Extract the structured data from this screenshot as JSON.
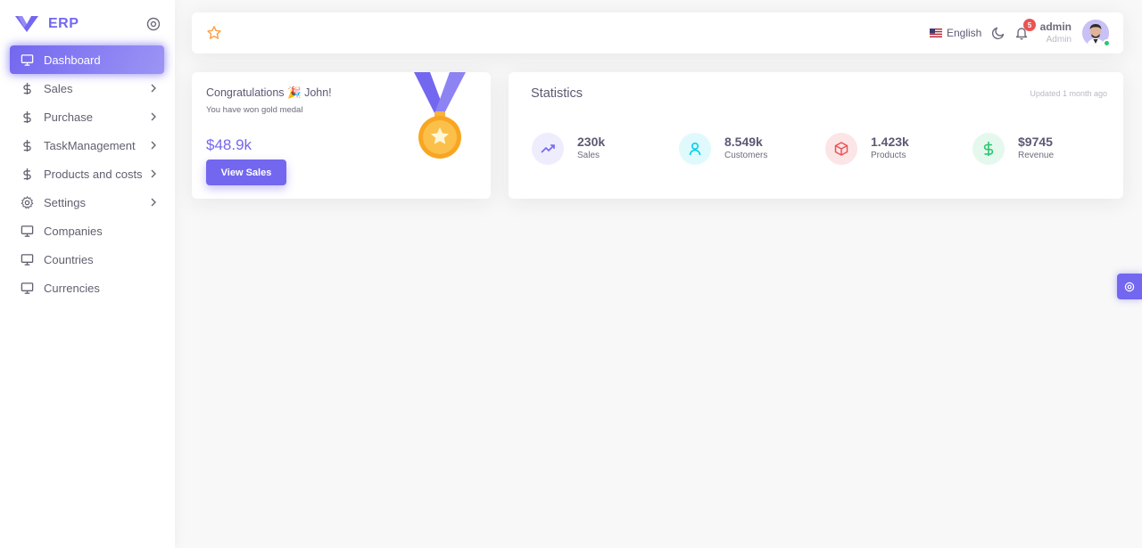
{
  "brand": {
    "name": "ERP"
  },
  "sidebar": {
    "items": [
      {
        "label": "Dashboard",
        "icon": "monitor-icon",
        "active": true,
        "has_children": false
      },
      {
        "label": "Sales",
        "icon": "dollar-icon",
        "active": false,
        "has_children": true
      },
      {
        "label": "Purchase",
        "icon": "dollar-icon",
        "active": false,
        "has_children": true
      },
      {
        "label": "TaskManagement",
        "icon": "dollar-icon",
        "active": false,
        "has_children": true
      },
      {
        "label": "Products and costs",
        "icon": "dollar-icon",
        "active": false,
        "has_children": true
      },
      {
        "label": "Settings",
        "icon": "gear-icon",
        "active": false,
        "has_children": true
      },
      {
        "label": "Companies",
        "icon": "monitor-icon",
        "active": false,
        "has_children": false
      },
      {
        "label": "Countries",
        "icon": "monitor-icon",
        "active": false,
        "has_children": false
      },
      {
        "label": "Currencies",
        "icon": "monitor-icon",
        "active": false,
        "has_children": false
      }
    ]
  },
  "navbar": {
    "language": "English",
    "notification_count": "5",
    "user_name": "admin",
    "user_role": "Admin"
  },
  "congrats": {
    "title": "Congratulations 🎉 John!",
    "subtitle": "You have won gold medal",
    "amount": "$48.9k",
    "button_label": "View Sales"
  },
  "statistics": {
    "title": "Statistics",
    "updated": "Updated 1 month ago",
    "items": [
      {
        "value": "230k",
        "label": "Sales",
        "icon": "trending-up-icon",
        "color": "#7367f0",
        "bg": "#eeedfd"
      },
      {
        "value": "8.549k",
        "label": "Customers",
        "icon": "user-icon",
        "color": "#00cfe8",
        "bg": "#e0f9fc"
      },
      {
        "value": "1.423k",
        "label": "Products",
        "icon": "box-icon",
        "color": "#ea5455",
        "bg": "#fce5e6"
      },
      {
        "value": "$9745",
        "label": "Revenue",
        "icon": "dollar-icon",
        "color": "#28c76f",
        "bg": "#e5f8ed"
      }
    ]
  },
  "colors": {
    "primary": "#7367f0",
    "danger": "#ea5455",
    "success": "#28c76f",
    "info": "#00cfe8"
  }
}
